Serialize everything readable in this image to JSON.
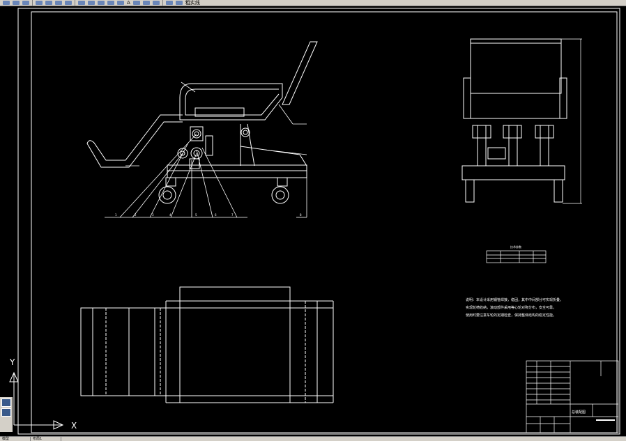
{
  "toolbar": {
    "layer_name": "粗实线",
    "text_style": "A"
  },
  "ucs": {
    "y_label": "Y",
    "x_label": "X"
  },
  "drawing": {
    "callouts": [
      "1",
      "2",
      "3",
      "4",
      "5",
      "6",
      "7",
      "8"
    ],
    "table_caption": "技术参数",
    "notes": [
      "说明：本设计采用钢管焊接，稳固，其中中间部分可实现折叠，",
      "实现轮椅收纳，滚动部件采用等心轮对称分布，安全可靠，",
      "使用时要注意车轮的定期检查，保持整体结构的稳定性能。"
    ],
    "title_block": {
      "drawing_title": "总装配图"
    }
  },
  "status_tabs": [
    "模型",
    "布局1"
  ]
}
